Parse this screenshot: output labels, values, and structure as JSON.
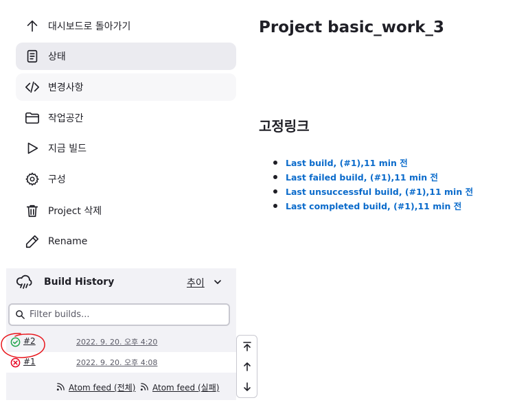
{
  "sidebar": {
    "items": [
      {
        "label": "대시보드로 돌아가기",
        "icon": "arrow-up-icon",
        "state": "normal"
      },
      {
        "label": "상태",
        "icon": "document-icon",
        "state": "active"
      },
      {
        "label": "변경사항",
        "icon": "code-icon",
        "state": "hover"
      },
      {
        "label": "작업공간",
        "icon": "folder-icon",
        "state": "normal"
      },
      {
        "label": "지금 빌드",
        "icon": "play-icon",
        "state": "normal"
      },
      {
        "label": "구성",
        "icon": "gear-icon",
        "state": "normal"
      },
      {
        "label": "Project 삭제",
        "icon": "trash-icon",
        "state": "normal"
      },
      {
        "label": "Rename",
        "icon": "pencil-icon",
        "state": "normal"
      }
    ]
  },
  "build_history": {
    "title": "Build History",
    "trend_label": "추이",
    "filter_placeholder": "Filter builds...",
    "builds": [
      {
        "number": "#2",
        "status": "success",
        "date": "2022. 9. 20. 오후 4:20"
      },
      {
        "number": "#1",
        "status": "failed",
        "date": "2022. 9. 20. 오후 4:08"
      }
    ],
    "feeds": {
      "all": "Atom feed (전체)",
      "failures": "Atom feed (실패)"
    }
  },
  "main": {
    "title": "Project basic_work_3",
    "permalinks_heading": "고정링크",
    "permalinks": [
      "Last build, (#1),11 min 전",
      "Last failed build, (#1),11 min 전",
      "Last unsuccessful build, (#1),11 min 전",
      "Last completed build, (#1),11 min 전"
    ]
  },
  "colors": {
    "accent_link": "#0b6bcb",
    "success": "#1ea64b",
    "failure": "#e6001f",
    "annotation": "#e8141a"
  }
}
